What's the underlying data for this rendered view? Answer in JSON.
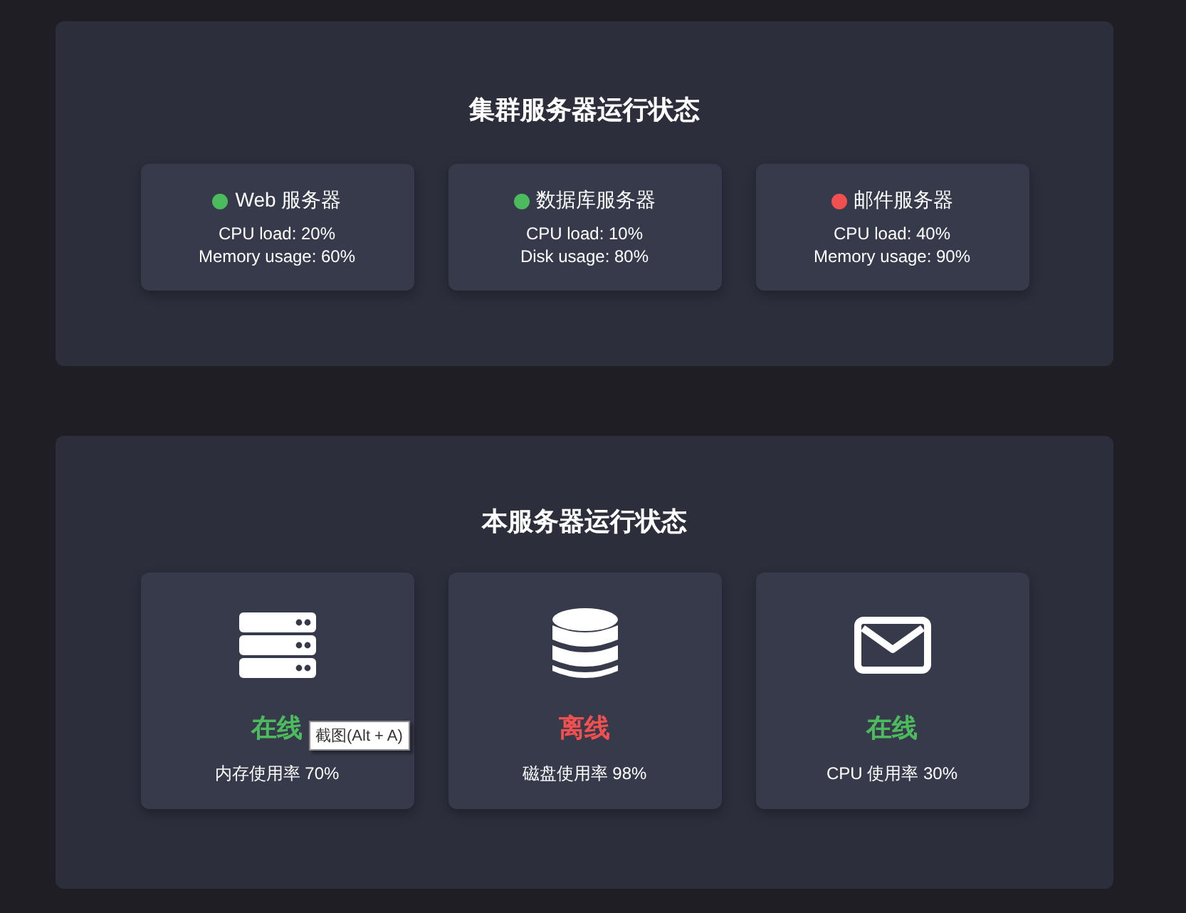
{
  "cluster": {
    "title": "集群服务器运行状态",
    "servers": [
      {
        "name": "Web 服务器",
        "color": "#4cbb5e",
        "lines": [
          "CPU load: 20%",
          "Memory usage: 60%"
        ]
      },
      {
        "name": "数据库服务器",
        "color": "#4cbb5e",
        "lines": [
          "CPU load: 10%",
          "Disk usage: 80%"
        ]
      },
      {
        "name": "邮件服务器",
        "color": "#f0504f",
        "lines": [
          "CPU load: 40%",
          "Memory usage: 90%"
        ]
      }
    ]
  },
  "local": {
    "title": "本服务器运行状态",
    "items": [
      {
        "kind": "server",
        "status": "在线",
        "online": true,
        "usage": "内存使用率 70%"
      },
      {
        "kind": "database",
        "status": "离线",
        "online": false,
        "usage": "磁盘使用率 98%"
      },
      {
        "kind": "mail",
        "status": "在线",
        "online": true,
        "usage": "CPU 使用率 30%"
      }
    ]
  },
  "tooltip": "截图(Alt + A)"
}
